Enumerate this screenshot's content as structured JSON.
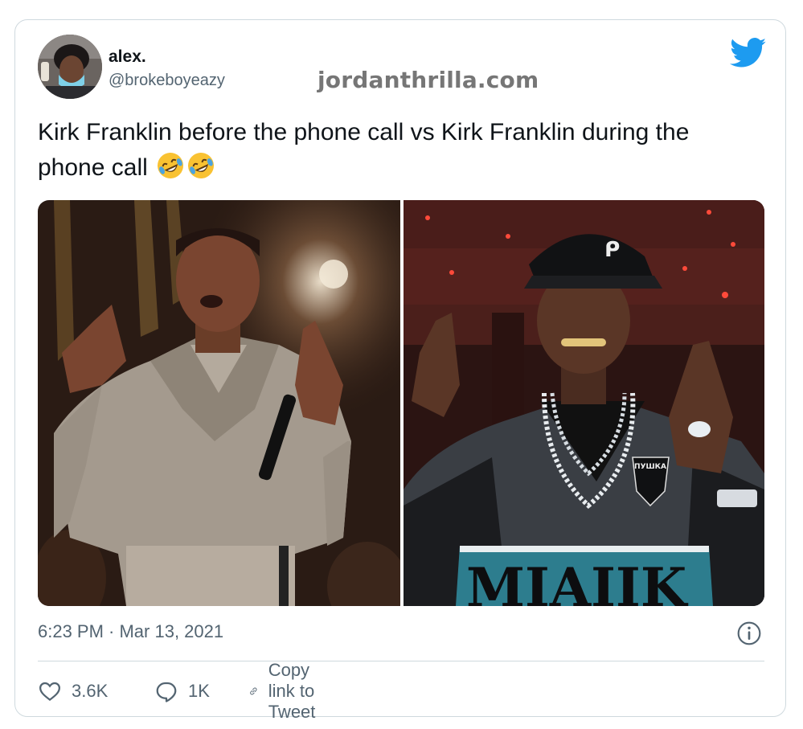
{
  "user": {
    "display_name": "alex.",
    "handle": "@brokeboyeazy"
  },
  "watermark": "jordanthrilla.com",
  "brand": {
    "icon": "twitter-bird-icon",
    "color": "#1d9bf0"
  },
  "tweet": {
    "text": "Kirk Franklin before the phone call vs Kirk Franklin during the phone call",
    "emojis": [
      "rolling-on-floor-laughing-emoji",
      "rolling-on-floor-laughing-emoji"
    ]
  },
  "media": {
    "left": {
      "icon": "photo-kirk-franklin-performing"
    },
    "right": {
      "icon": "photo-rapper-black-cap"
    },
    "right_shirt_text": "MIAIIK",
    "right_patch_text": "ПУШКА"
  },
  "timestamp": "6:23 PM · Mar 13, 2021",
  "actions": {
    "like_count": "3.6K",
    "reply_count": "1K",
    "copy_link_label": "Copy link to Tweet"
  },
  "colors": {
    "text": "#0f1419",
    "secondary": "#536471",
    "border": "#cfd9de",
    "emoji_face": "#f9c232"
  }
}
